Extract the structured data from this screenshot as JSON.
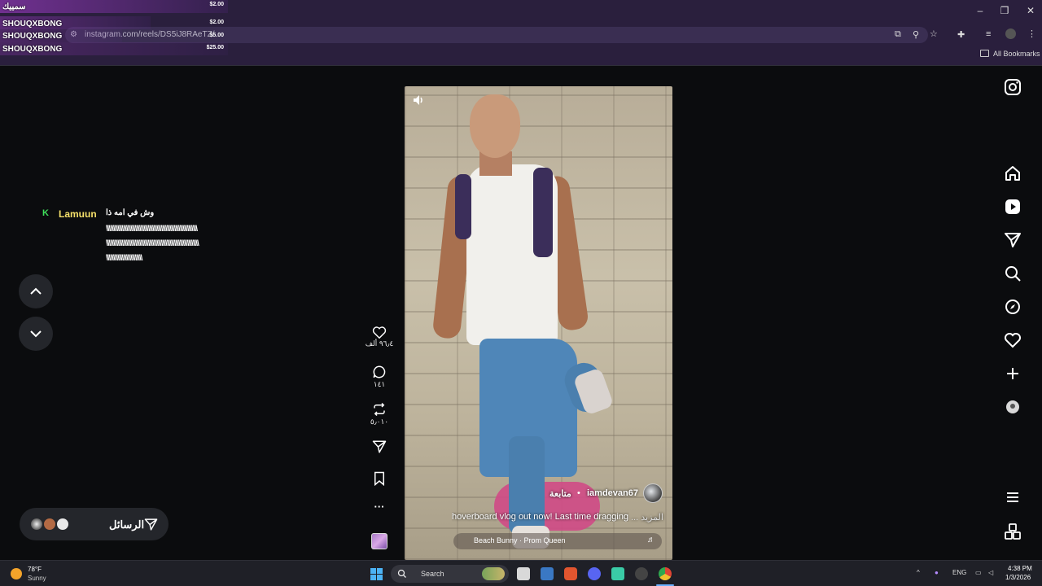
{
  "browser": {
    "url": "instagram.com/reels/DS5iJ8RAeTZ/",
    "bookmarks_label": "All Bookmarks",
    "min": "–",
    "restore": "❐",
    "close": "✕"
  },
  "donations": {
    "title": "سمييك",
    "title_amount": "$2.00",
    "rows": [
      {
        "name": "SHOUQXBONG",
        "amount": "$2.00"
      },
      {
        "name": "SHOUQXBONG",
        "amount": "$5.00"
      },
      {
        "name": "SHOUQXBONG",
        "amount": "$25.00"
      }
    ]
  },
  "chat": {
    "badge": "K",
    "user": "Lamuun",
    "message": "وش في امه ذا",
    "line1": "ٰٰٰٰٰٰٰٰٰٰٰٰٰٰٰٰٰٰٰٰٰٰٰٰٰٰٰٰٰٰٰٰٰٰٰٰٰٰٰٰٰٰٰٰٰٰٰٰٰٰٰٰٰٰٰٰٰٰٰٰٰٰٰٰٰٰ",
    "line2": "ٰٰٰٰٰٰٰٰٰٰٰٰٰٰٰٰٰٰٰٰٰٰٰٰٰٰٰٰٰٰٰٰٰٰٰٰٰٰٰٰٰٰٰٰٰٰٰٰٰٰٰٰٰٰٰٰٰٰٰٰٰٰٰٰٰٰ",
    "line3": "ٰٰٰٰٰٰٰٰٰٰٰٰٰٰٰٰٰٰٰٰٰٰٰٰٰٰٰٰٰٰٰ"
  },
  "reel": {
    "username": "iamdevan67",
    "follow_label": "متابعة",
    "caption": "hoverboard vlog out now! Last time dragging",
    "more_label": "... المزيد",
    "music": "Beach Bunny · Prom Queen",
    "music_icon": "♬"
  },
  "actions": {
    "likes": "٩٦٫٤ ألف",
    "comments": "١٤١",
    "reposts": "٥٫٠١٠",
    "more": "···"
  },
  "messages": {
    "label": "الرسائل"
  },
  "taskbar": {
    "temp": "78°F",
    "condition": "Sunny",
    "search_label": "Search",
    "lang": "ENG",
    "time": "4:38 PM",
    "date": "1/3/2026",
    "tray_up": "^"
  },
  "colors": {
    "chrome_bg": "#2a1f3d",
    "page_bg": "#0b0c0e",
    "chat_user": "#f5e06a",
    "chat_badge": "#3fe05a"
  },
  "icons": [
    "instagram-icon",
    "home-icon",
    "reels-icon",
    "send-icon",
    "search-icon",
    "explore-icon",
    "heart-icon",
    "plus-icon",
    "profile-icon",
    "menu-icon",
    "more-apps-icon",
    "mute-icon",
    "like-icon",
    "comment-icon",
    "repost-icon",
    "share-icon",
    "save-icon"
  ]
}
